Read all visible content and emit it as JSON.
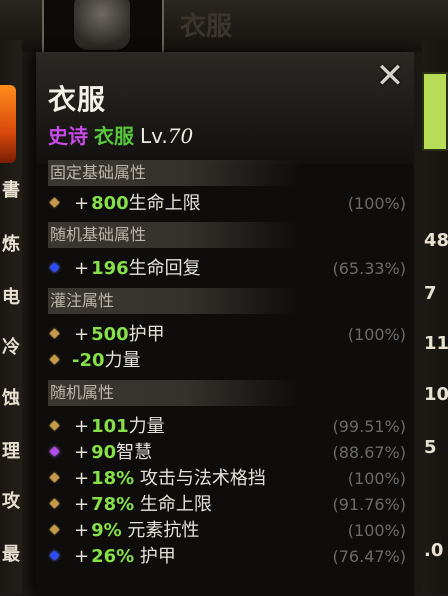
{
  "background": {
    "top_text": "衣服",
    "left_chars": [
      "書",
      "炼",
      "电",
      "冷",
      "蚀",
      "理",
      "攻",
      "最"
    ],
    "right_nums": [
      "48",
      "7",
      "11",
      "10",
      "5",
      ".0"
    ]
  },
  "tooltip": {
    "close_label": "✕",
    "title": "衣服",
    "rarity": "史诗",
    "item_type": "衣服",
    "level_prefix": "Lv.",
    "level": "70",
    "sections": [
      {
        "header": "固定基础属性",
        "rows": [
          {
            "gem": "gold",
            "sign": "+",
            "value": "800",
            "label": "生命上限",
            "pct": "(100%)"
          }
        ]
      },
      {
        "header": "随机基础属性",
        "rows": [
          {
            "gem": "blue",
            "sign": "+",
            "value": "196",
            "label": "生命回复",
            "pct": "(65.33%)"
          }
        ]
      },
      {
        "header": "灌注属性",
        "rows": [
          {
            "gem": "gold",
            "sign": "+",
            "value": "500",
            "label": "护甲",
            "pct": "(100%)"
          },
          {
            "gem": "gold",
            "sign": "",
            "value": "-20",
            "label": "力量",
            "pct": ""
          }
        ]
      },
      {
        "header": "随机属性",
        "rows": [
          {
            "gem": "gold",
            "sign": "+",
            "value": "101",
            "label": "力量",
            "pct": "(99.51%)"
          },
          {
            "gem": "purple",
            "sign": "+",
            "value": "90",
            "label": "智慧",
            "pct": "(88.67%)"
          },
          {
            "gem": "gold",
            "sign": "+",
            "value": "18%",
            "label": " 攻击与法术格挡",
            "pct": "(100%)"
          },
          {
            "gem": "gold",
            "sign": "+",
            "value": "78%",
            "label": " 生命上限",
            "pct": "(91.76%)"
          },
          {
            "gem": "gold",
            "sign": "+",
            "value": "9%",
            "label": " 元素抗性",
            "pct": "(100%)"
          },
          {
            "gem": "blue",
            "sign": "+",
            "value": "26%",
            "label": " 护甲",
            "pct": "(76.47%)"
          }
        ]
      }
    ]
  }
}
